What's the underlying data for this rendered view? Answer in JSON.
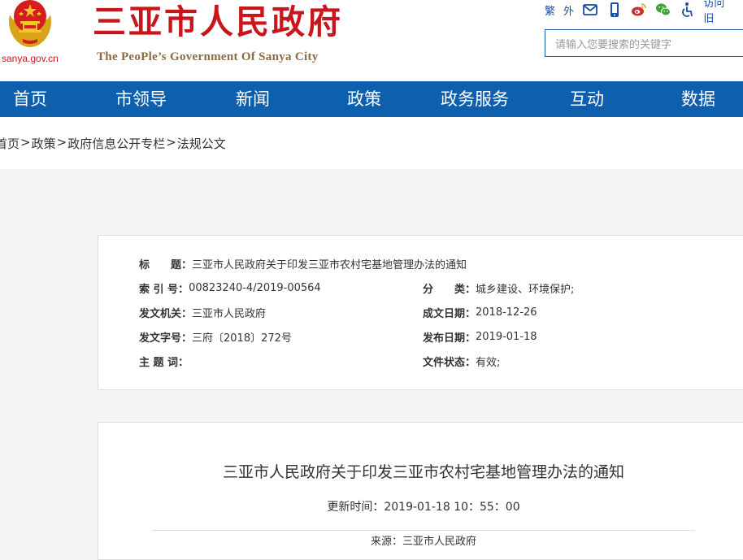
{
  "header": {
    "site_title": "三亚市人民政府",
    "site_subtitle": "The PeoPle’s Government Of Sanya City",
    "domain": "sanya.gov.cn",
    "colors": {
      "red": "#c8161d",
      "gold": "#8b6a3e",
      "blue": "#0e5fae"
    },
    "tools": {
      "traditional": "繁",
      "foreign": "外",
      "visit_history": "访问旧"
    },
    "icons": [
      "mail-icon",
      "mobile-icon",
      "weibo-icon",
      "wechat-icon",
      "accessibility-icon"
    ],
    "search_placeholder": "请输入您要搜索的关键字"
  },
  "nav": {
    "items": [
      "首页",
      "市领导",
      "新闻",
      "政策",
      "政务服务",
      "互动",
      "数据"
    ]
  },
  "breadcrumb": {
    "items": [
      "首页",
      "政策",
      "政府信息公开专栏",
      "法规公文"
    ],
    "separator": ">"
  },
  "meta": {
    "title_label": "标　　题：",
    "title_value": "三亚市人民政府关于印发三亚市农村宅基地管理办法的通知",
    "index_label": "索 引 号：",
    "index_value": "00823240-4/2019-00564",
    "category_label": "分　　类：",
    "category_value": "城乡建设、环境保护;",
    "issuer_label": "发文机关：",
    "issuer_value": "三亚市人民政府",
    "written_label": "成文日期：",
    "written_value": "2018-12-26",
    "docno_label": "发文字号：",
    "docno_value": "三府〔2018〕272号",
    "published_label": "发布日期：",
    "published_value": "2019-01-18",
    "subject_label": "主 题 词：",
    "subject_value": "",
    "status_label": "文件状态：",
    "status_value": "有效;"
  },
  "article": {
    "title": "三亚市人民政府关于印发三亚市农村宅基地管理办法的通知",
    "updated": "更新时间：2019-01-18 10：55：00",
    "source": "来源：三亚市人民政府"
  }
}
